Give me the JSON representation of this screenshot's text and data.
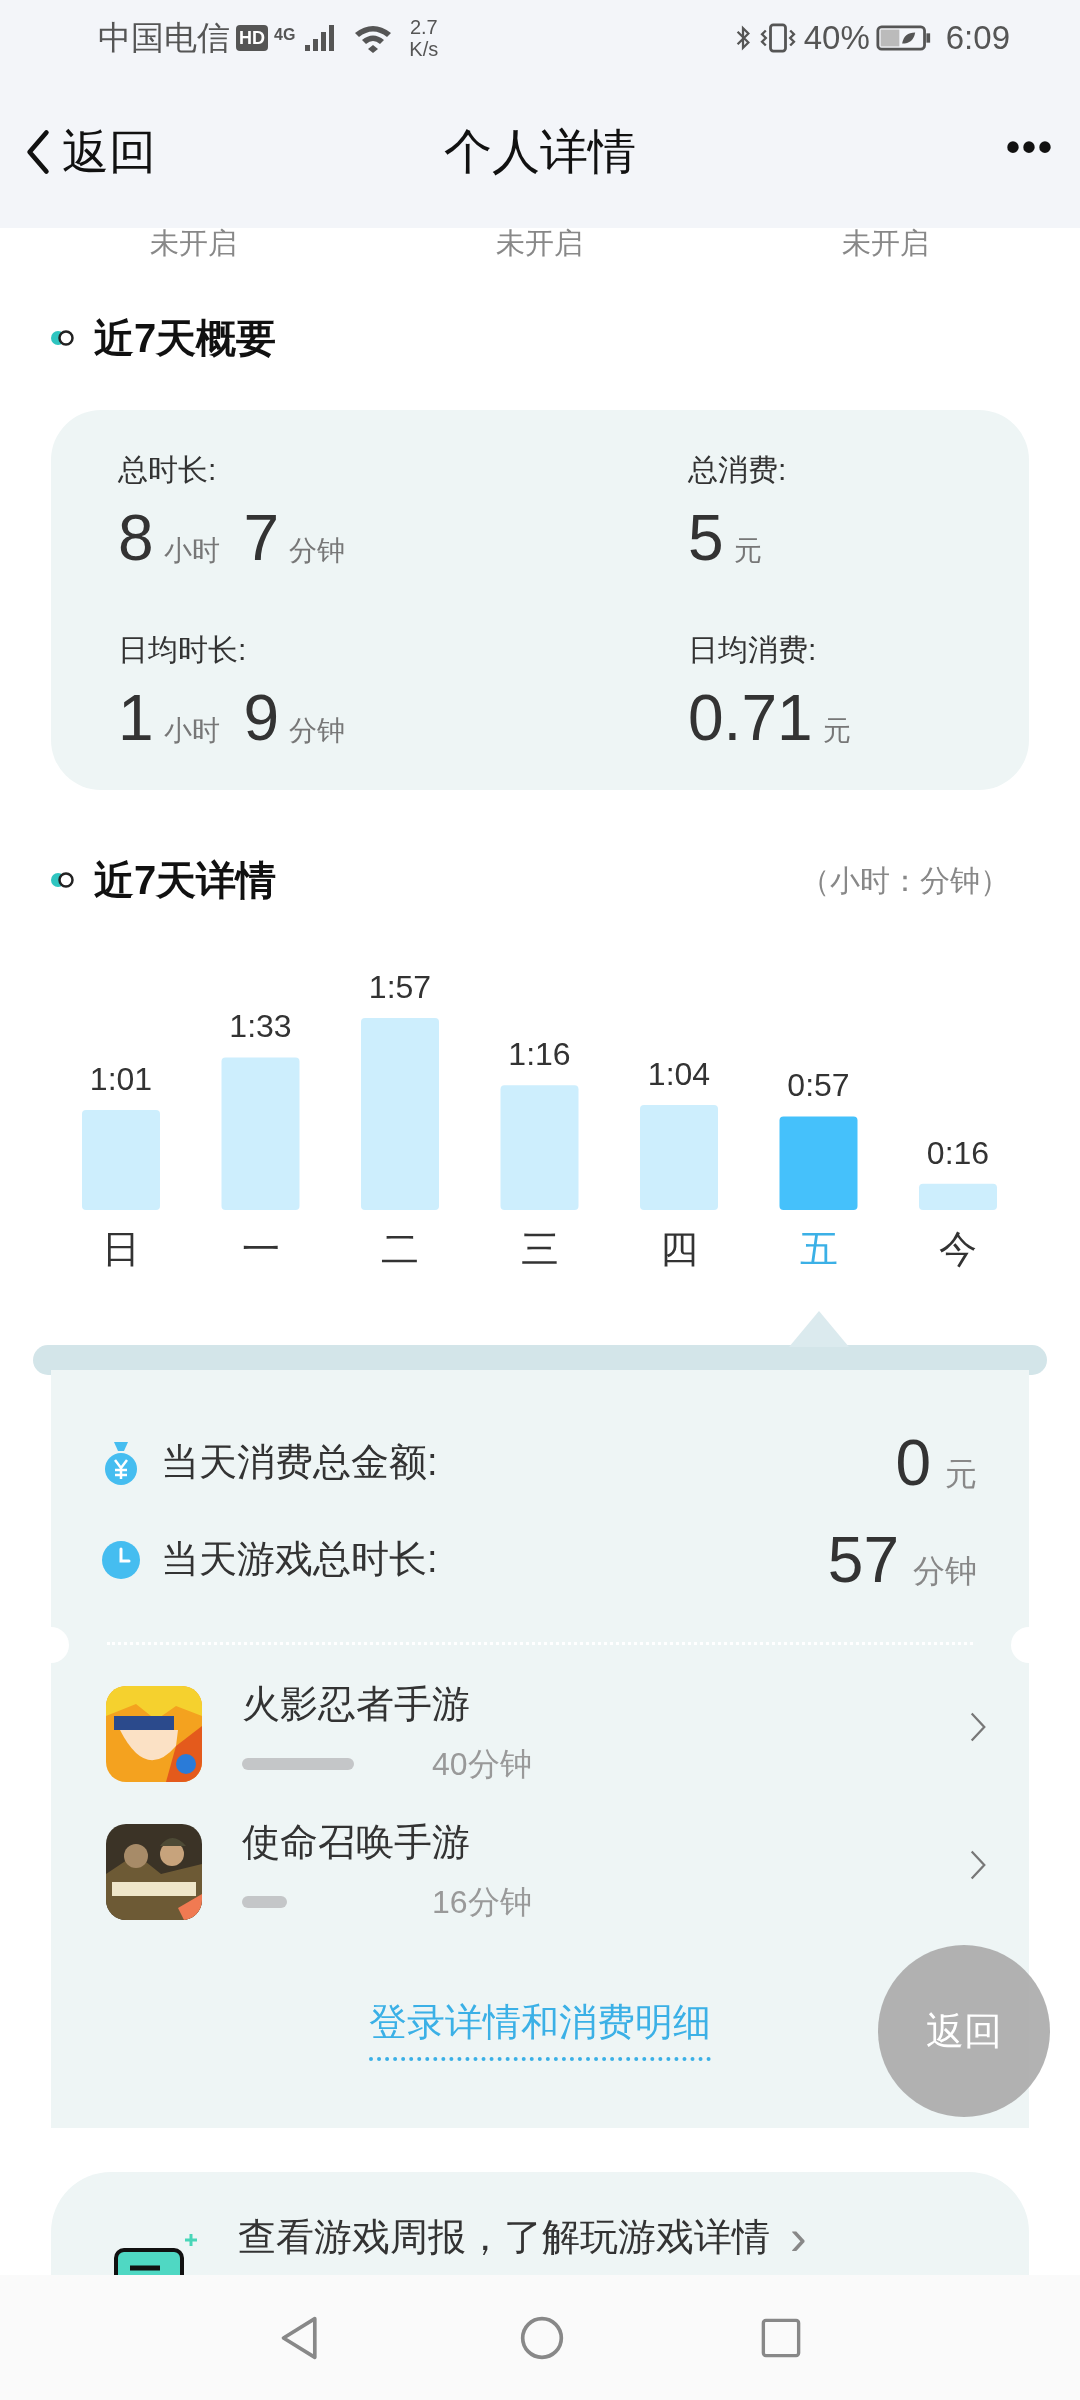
{
  "status_bar": {
    "carrier": "中国电信",
    "hd_badge": "HD",
    "network": "4G",
    "speed_value": "2.7",
    "speed_unit": "K/s",
    "battery": "40%",
    "time": "6:09"
  },
  "header": {
    "back_label": "返回",
    "title": "个人详情",
    "more": "•••"
  },
  "settings_states": [
    "未开启",
    "未开启",
    "未开启"
  ],
  "summary": {
    "title": "近7天概要",
    "items": [
      {
        "label": "总时长:",
        "parts": [
          {
            "value": "8",
            "unit": "小时"
          },
          {
            "value": "7",
            "unit": "分钟"
          }
        ]
      },
      {
        "label": "总消费:",
        "parts": [
          {
            "value": "5",
            "unit": "元"
          }
        ]
      },
      {
        "label": "日均时长:",
        "parts": [
          {
            "value": "1",
            "unit": "小时"
          },
          {
            "value": "9",
            "unit": "分钟"
          }
        ]
      },
      {
        "label": "日均消费:",
        "parts": [
          {
            "value": "0.71",
            "unit": "元"
          }
        ]
      }
    ]
  },
  "details": {
    "title": "近7天详情",
    "unit_note": "（小时：分钟）",
    "chart_data": {
      "type": "bar",
      "categories": [
        "日",
        "一",
        "二",
        "三",
        "四",
        "五",
        "今"
      ],
      "values": [
        61,
        93,
        117,
        76,
        64,
        57,
        16
      ],
      "value_labels": [
        "1:01",
        "1:33",
        "1:57",
        "1:16",
        "1:04",
        "0:57",
        "0:16"
      ]
    },
    "bar_selected": [
      false,
      false,
      false,
      false,
      false,
      true,
      false
    ]
  },
  "day_panel": {
    "rows": [
      {
        "kind": "money",
        "label": "当天消费总金额:",
        "value": "0",
        "unit": "元"
      },
      {
        "kind": "time",
        "label": "当天游戏总时长:",
        "value": "57",
        "unit": "分钟"
      }
    ],
    "games": [
      {
        "name": "火影忍者手游",
        "level": 0.7,
        "time": "40分钟",
        "kind": "picture"
      },
      {
        "name": "使命召唤手游",
        "level": 0.28,
        "time": "16分钟",
        "kind": "picture"
      }
    ],
    "link": "登录详情和消费明细"
  },
  "float_button": "返回",
  "weekly_card": {
    "title": "查看游戏周报，了解玩游戏详情",
    "arrow": "›"
  }
}
